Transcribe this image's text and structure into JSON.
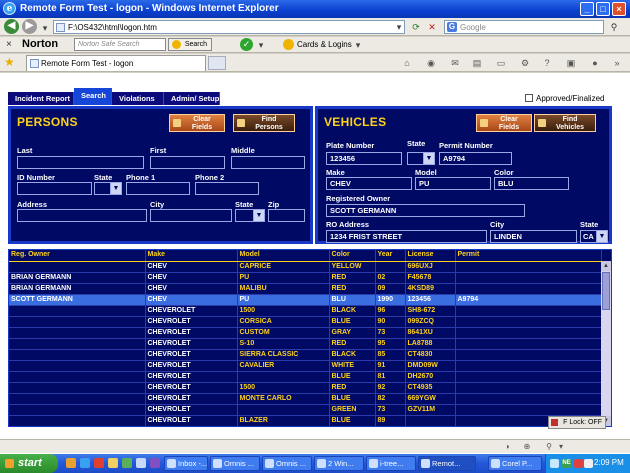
{
  "window": {
    "title": "Remote Form Test - logon - Windows Internet Explorer",
    "ie_letter": "e"
  },
  "address_bar": {
    "url": "F:\\OS432\\html\\logon.htm",
    "search_placeholder": "Google",
    "search_logo": "G"
  },
  "norton": {
    "close_glyph": "×",
    "logo": "Norton",
    "search_placeholder": "Norton Safe Search",
    "search_button": "Search",
    "cards_logins": "Cards & Logins"
  },
  "browser_tab": {
    "label": "Remote Form Test - logon"
  },
  "app": {
    "tabs": [
      "Incident Report",
      "Search",
      "Violations",
      "Admin/ Setup"
    ],
    "active_tab": "Search",
    "approved_label": "Approved/Finalized"
  },
  "persons": {
    "title": "PERSONS",
    "clear_button": [
      "Clear",
      "Fields"
    ],
    "find_button": [
      "Find",
      "Persons"
    ],
    "labels": {
      "last": "Last",
      "first": "First",
      "middle": "Middle",
      "id_number": "ID Number",
      "state": "State",
      "phone1": "Phone 1",
      "phone2": "Phone 2",
      "address": "Address",
      "city": "City",
      "state2": "State",
      "zip": "Zip"
    }
  },
  "vehicles": {
    "title": "VEHICLES",
    "clear_button": [
      "Clear",
      "Fields"
    ],
    "find_button": [
      "Find",
      "Vehicles"
    ],
    "labels": {
      "plate": "Plate Number",
      "state": "State",
      "permit": "Permit Number",
      "make": "Make",
      "model": "Model",
      "color": "Color",
      "reg_owner": "Registered Owner",
      "ro_address": "RO Address",
      "city": "City",
      "state2": "State"
    },
    "values": {
      "plate": "123456",
      "state": "",
      "permit": "A9794",
      "make": "CHEV",
      "model": "PU",
      "color": "BLU",
      "reg_owner": "SCOTT GERMANN",
      "ro_address": "1234 FRIST STREET",
      "city": "LINDEN",
      "state2": "CA"
    }
  },
  "grid": {
    "headers": [
      "Reg. Owner",
      "Make",
      "Model",
      "Color",
      "Year",
      "License",
      "Permit"
    ],
    "rows": [
      [
        "",
        "CHEV",
        "CAPRICE",
        "YELLOW",
        "",
        "696UXJ",
        ""
      ],
      [
        "BRIAN GERMANN",
        "CHEV",
        "PU",
        "RED",
        "02",
        "F45678",
        ""
      ],
      [
        "BRIAN GERMANN",
        "CHEV",
        "MALIBU",
        "RED",
        "09",
        "4KSD89",
        ""
      ],
      [
        "SCOTT GERMANN",
        "CHEV",
        "PU",
        "BLU",
        "1990",
        "123456",
        "A9794"
      ],
      [
        "",
        "CHEVEROLET",
        "1500",
        "BLACK",
        "96",
        "SH8-672",
        ""
      ],
      [
        "",
        "CHEVROLET",
        "CORSICA",
        "BLUE",
        "90",
        "099ZCQ",
        ""
      ],
      [
        "",
        "CHEVROLET",
        "CUSTOM",
        "GRAY",
        "73",
        "8641XU",
        ""
      ],
      [
        "",
        "CHEVROLET",
        "S-10",
        "RED",
        "95",
        "LA8788",
        ""
      ],
      [
        "",
        "CHEVROLET",
        "SIERRA CLASSIC",
        "BLACK",
        "85",
        "CT4830",
        ""
      ],
      [
        "",
        "CHEVROLET",
        "CAVALIER",
        "WHITE",
        "91",
        "DMD09W",
        ""
      ],
      [
        "",
        "CHEVROLET",
        "",
        "BLUE",
        "81",
        "DH2670",
        ""
      ],
      [
        "",
        "CHEVROLET",
        "1500",
        "RED",
        "92",
        "CT4935",
        ""
      ],
      [
        "",
        "CHEVROLET",
        "MONTE CARLO",
        "BLUE",
        "82",
        "669YGW",
        ""
      ],
      [
        "",
        "CHEVROLET",
        "",
        "GREEN",
        "73",
        "GZV11M",
        ""
      ],
      [
        "",
        "CHEVROLET",
        "BLAZER",
        "BLUE",
        "89",
        "",
        ""
      ]
    ],
    "selected_row": 3,
    "flock_label": "F Lock: OFF"
  },
  "taskbar": {
    "start": "start",
    "tasks": [
      "Inbox -...",
      "Omnis ...",
      "Omnis ...",
      "2 Win...",
      "i-tree...",
      "Remot...",
      "Corel P..."
    ],
    "active_task": 5,
    "tray_label": "NE",
    "clock": "2:09 PM"
  },
  "colors": {
    "panel_bg": "#000a64",
    "panel_border": "#1838c8",
    "heading": "#ffd21a",
    "selected_row": "#3a6ee0",
    "active_tab": "#1646d8",
    "inactive_tab": "#0a0a7a",
    "taskbar": "#2456d8",
    "start_green": "#48b048"
  }
}
